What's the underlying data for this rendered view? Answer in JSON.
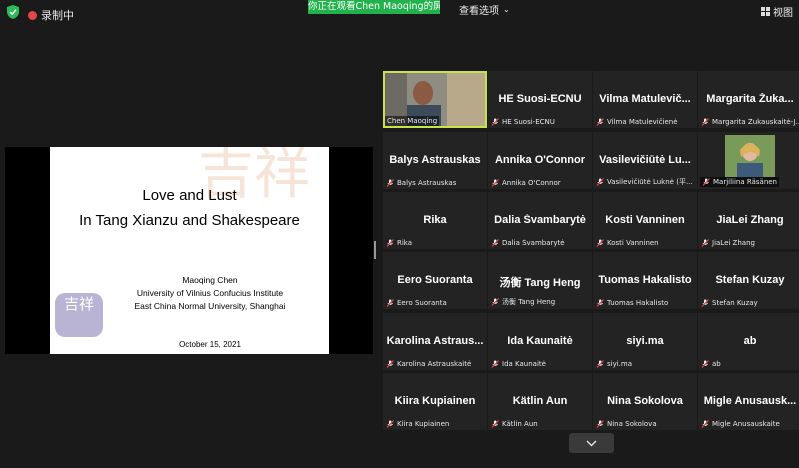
{
  "topbar": {
    "recording_label": "录制中",
    "share_banner": "你正在观看Chen  Maoqing的屏幕",
    "view_options_label": "查看选项",
    "view_label": "视图"
  },
  "slide": {
    "title_line1": "Love and Lust",
    "title_line2": "In Tang Xianzu and Shakespeare",
    "presenter": "Maoqing Chen",
    "affiliation1": "University of Vilnius Confucius Institute",
    "affiliation2": "East China Normal University, Shanghai",
    "date": "October 15, 2021",
    "decor_text": "吉祥",
    "logo_text": "吉祥"
  },
  "participants": [
    {
      "name": "",
      "label": "Chen Maoqing",
      "video": true,
      "active": true,
      "muted": false
    },
    {
      "name": "HE Suosi-ECNU",
      "label": "HE Suosi-ECNU",
      "muted": true
    },
    {
      "name": "Vilma Matulevič...",
      "label": "Vilma Matulevičienė",
      "muted": true
    },
    {
      "name": "Margarita Žuka...",
      "label": "Margarita Žukauskaitė-J...",
      "muted": true
    },
    {
      "name": "Balys Astrauskas",
      "label": "Balys Astrauskas",
      "muted": true
    },
    {
      "name": "Annika O'Connor",
      "label": "Annika O'Connor",
      "muted": true
    },
    {
      "name": "Vasilevičiūtė  Lu...",
      "label": "Vasilevičiūtė Luknė (平...",
      "muted": true
    },
    {
      "name": "",
      "label": "Marjiliina Räsänen",
      "video": true,
      "muted": true
    },
    {
      "name": "Rika",
      "label": "Rika",
      "muted": true
    },
    {
      "name": "Dalia Švambarytė",
      "label": "Dalia Švambarytė",
      "muted": true
    },
    {
      "name": "Kosti Vanninen",
      "label": "Kosti Vanninen",
      "muted": true
    },
    {
      "name": "JiaLei Zhang",
      "label": "JiaLei Zhang",
      "muted": true
    },
    {
      "name": "Eero Suoranta",
      "label": "Eero Suoranta",
      "muted": true
    },
    {
      "name": "汤衡  Tang  Heng",
      "label": "汤衡 Tang Heng",
      "muted": true
    },
    {
      "name": "Tuomas Hakalisto",
      "label": "Tuomas Hakalisto",
      "muted": true
    },
    {
      "name": "Stefan Kuzay",
      "label": "Stefan Kuzay",
      "muted": true
    },
    {
      "name": "Karolina  Astraus...",
      "label": "Karolina Astrauskaitė",
      "muted": true
    },
    {
      "name": "Ida Kaunaitė",
      "label": "Ida Kaunaitė",
      "muted": true
    },
    {
      "name": "siyi.ma",
      "label": "siyi.ma",
      "muted": true
    },
    {
      "name": "ab",
      "label": "ab",
      "muted": true
    },
    {
      "name": "Kiira Kupiainen",
      "label": "Kiira Kupiainen",
      "muted": true
    },
    {
      "name": "Kätlin Aun",
      "label": "Kätlin Aun",
      "muted": true
    },
    {
      "name": "Nina Sokolova",
      "label": "Nina Sokolova",
      "muted": true
    },
    {
      "name": "Migle  Anusausk...",
      "label": "Migle Anusauskaite",
      "muted": true
    }
  ],
  "colors": {
    "banner": "#23b14d",
    "active_speaker": "#c8e34a",
    "mute_icon": "#e24848"
  }
}
